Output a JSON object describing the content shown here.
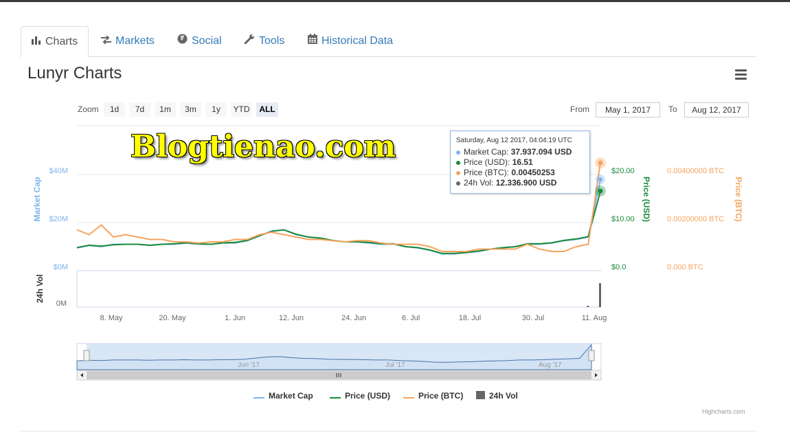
{
  "tabs": [
    {
      "label": "Charts",
      "icon": "bar-chart-icon",
      "active": true
    },
    {
      "label": "Markets",
      "icon": "exchange-icon",
      "active": false
    },
    {
      "label": "Social",
      "icon": "globe-icon",
      "active": false
    },
    {
      "label": "Tools",
      "icon": "wrench-icon",
      "active": false
    },
    {
      "label": "Historical Data",
      "icon": "calendar-icon",
      "active": false
    }
  ],
  "title": "Lunyr Charts",
  "menu_icon": "hamburger-menu-icon",
  "range_selector": {
    "zoom_label": "Zoom",
    "buttons": [
      "1d",
      "7d",
      "1m",
      "3m",
      "1y",
      "YTD",
      "ALL"
    ],
    "active": "ALL",
    "from_label": "From",
    "from_value": "May 1, 2017",
    "to_label": "To",
    "to_value": "Aug 12, 2017"
  },
  "watermark": "Blogtienao.com",
  "tooltip": {
    "date": "Saturday, Aug 12 2017, 04:04:19 UTC",
    "rows": [
      {
        "label": "Market Cap:",
        "value": "37.937.094 USD",
        "color": "#7cb5ec"
      },
      {
        "label": "Price (USD):",
        "value": "16.51",
        "color": "#1a8a3a"
      },
      {
        "label": "Price (BTC):",
        "value": "0.00450253",
        "color": "#f7a35c"
      },
      {
        "label": "24h Vol:",
        "value": "12.336.900 USD",
        "color": "#666666"
      }
    ]
  },
  "legend": [
    {
      "label": "Market Cap",
      "color": "#7cb5ec",
      "symbol": "line"
    },
    {
      "label": "Price (USD)",
      "color": "#1a8a3a",
      "symbol": "line"
    },
    {
      "label": "Price (BTC)",
      "color": "#f7a35c",
      "symbol": "line"
    },
    {
      "label": "24h Vol",
      "color": "#666666",
      "symbol": "square"
    }
  ],
  "credits": "Highcharts.com",
  "chart_data": {
    "type": "line",
    "title": "Lunyr Charts",
    "x_labels": [
      "8. May",
      "20. May",
      "1. Jun",
      "12. Jun",
      "24. Jun",
      "6. Jul",
      "18. Jul",
      "30. Jul",
      "11. Aug"
    ],
    "x_range": [
      "2017-05-01",
      "2017-08-12"
    ],
    "axes": {
      "market_cap": {
        "title": "Market Cap",
        "ticks": [
          "$0M",
          "$20M",
          "$40M"
        ],
        "range": [
          0,
          40000000
        ],
        "color": "#7cb5ec"
      },
      "price_usd": {
        "title": "Price (USD)",
        "ticks": [
          "$0.0",
          "$10.00",
          "$20.00"
        ],
        "range": [
          0,
          20
        ],
        "color": "#1a8a3a"
      },
      "price_btc": {
        "title": "Price (BTC)",
        "ticks": [
          "0.000 BTC",
          "0.00200000 BTC",
          "0.00400000 BTC"
        ],
        "range": [
          0,
          0.004
        ],
        "color": "#f7a35c"
      },
      "volume": {
        "title": "24h Vol",
        "ticks": [
          "0M"
        ]
      }
    },
    "navigator_labels": [
      "Jun '17",
      "Jul '17",
      "Aug '17"
    ],
    "series": [
      {
        "name": "Market Cap",
        "color": "#7cb5ec",
        "values": [
          9.5,
          10.5,
          10.0,
          11.0,
          11.0,
          11.0,
          10.5,
          11.0,
          11.0,
          11.5,
          11.0,
          11.0,
          11.5,
          11.5,
          12.5,
          14.5,
          16.5,
          17.0,
          15.0,
          14.0,
          13.5,
          12.5,
          12.0,
          12.0,
          11.5,
          11.0,
          11.0,
          10.0,
          9.5,
          8.5,
          7.0,
          7.0,
          7.5,
          8.0,
          9.0,
          9.5,
          10.0,
          11.0,
          11.0,
          11.5,
          12.5,
          13.0,
          14.0,
          37.9
        ]
      },
      {
        "name": "Price (USD)",
        "color": "#1a8a3a",
        "values": [
          4.8,
          5.3,
          5.1,
          5.4,
          5.5,
          5.5,
          5.3,
          5.5,
          5.6,
          5.8,
          5.6,
          5.5,
          5.8,
          5.9,
          6.3,
          7.3,
          8.2,
          8.5,
          7.6,
          7.0,
          6.8,
          6.3,
          6.0,
          6.0,
          5.9,
          5.6,
          5.6,
          5.0,
          4.8,
          4.3,
          3.6,
          3.6,
          3.8,
          4.1,
          4.5,
          4.8,
          5.0,
          5.6,
          5.6,
          5.8,
          6.3,
          6.6,
          7.1,
          16.51
        ]
      },
      {
        "name": "Price (BTC)",
        "color": "#f7a35c",
        "values": [
          0.0017,
          0.0015,
          0.0019,
          0.0014,
          0.0015,
          0.0014,
          0.0013,
          0.0013,
          0.0012,
          0.0012,
          0.00115,
          0.0012,
          0.0012,
          0.0013,
          0.0013,
          0.0015,
          0.0016,
          0.0015,
          0.0014,
          0.0013,
          0.0013,
          0.00125,
          0.0012,
          0.00125,
          0.00125,
          0.00115,
          0.0011,
          0.0011,
          0.0011,
          0.001,
          0.0008,
          0.0008,
          0.0008,
          0.0009,
          0.0009,
          0.0009,
          0.0009,
          0.0011,
          0.0009,
          0.0008,
          0.0008,
          0.001,
          0.0011,
          0.0045
        ]
      },
      {
        "name": "24h Vol",
        "color": "#666666",
        "values": [
          0,
          0,
          0,
          0,
          0,
          0,
          0,
          0,
          0,
          0,
          0,
          0,
          0,
          0,
          0,
          0,
          0,
          0,
          0,
          0,
          0,
          0,
          0,
          0,
          0,
          0,
          0,
          0,
          0,
          0,
          0,
          0,
          0,
          0,
          0,
          0,
          0,
          0,
          0,
          0,
          0,
          0,
          0.5,
          12.3
        ]
      }
    ]
  }
}
